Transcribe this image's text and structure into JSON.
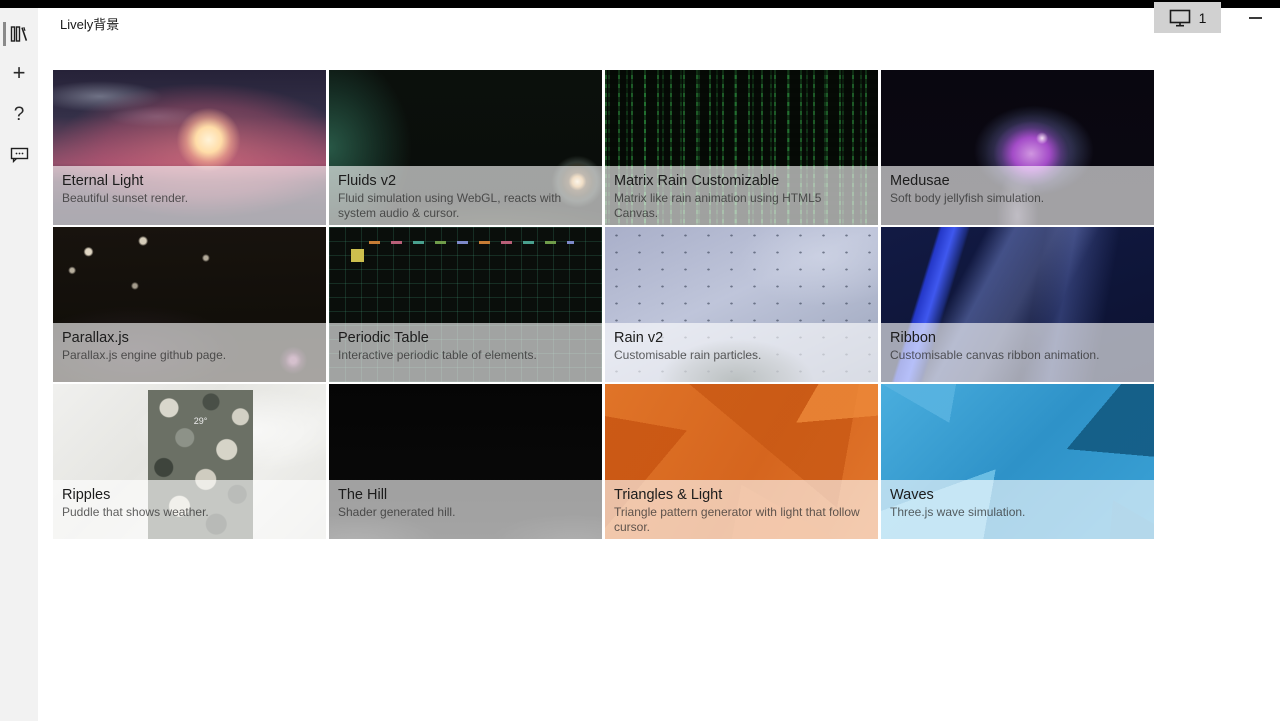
{
  "window": {
    "title": "Lively背景",
    "display_button": {
      "label": "1",
      "icon": "monitor-icon"
    },
    "minimize": {
      "icon": "minimize-icon"
    }
  },
  "sidebar": {
    "items": [
      {
        "id": "library",
        "icon": "library-icon",
        "selected": true
      },
      {
        "id": "add-wallpaper",
        "icon": "plus-icon",
        "glyph": "+"
      },
      {
        "id": "help",
        "icon": "help-icon",
        "glyph": "?"
      },
      {
        "id": "feedback",
        "icon": "feedback-icon"
      }
    ]
  },
  "cards": [
    {
      "title": "Eternal Light",
      "description": "Beautiful sunset render.",
      "thumb": "eternal-light"
    },
    {
      "title": "Fluids v2",
      "description": "Fluid simulation using WebGL, reacts with system audio & cursor.",
      "thumb": "fluids-v2"
    },
    {
      "title": "Matrix Rain Customizable",
      "description": "Matrix like rain animation using HTML5 Canvas.",
      "thumb": "matrix-rain"
    },
    {
      "title": "Medusae",
      "description": "Soft body jellyfish simulation.",
      "thumb": "medusae"
    },
    {
      "title": "Parallax.js",
      "description": "Parallax.js engine github page.",
      "thumb": "parallax-js"
    },
    {
      "title": "Periodic Table",
      "description": "Interactive periodic table of elements.",
      "thumb": "periodic-table"
    },
    {
      "title": "Rain v2",
      "description": "Customisable rain particles.",
      "thumb": "rain-v2"
    },
    {
      "title": "Ribbon",
      "description": "Customisable canvas ribbon animation.",
      "thumb": "ribbon"
    },
    {
      "title": "Ripples",
      "description": "Puddle that shows weather.",
      "thumb": "ripples",
      "overlay_text": "29°"
    },
    {
      "title": "The Hill",
      "description": "Shader generated hill.",
      "thumb": "the-hill"
    },
    {
      "title": "Triangles & Light",
      "description": "Triangle pattern generator with light that follow cursor.",
      "thumb": "triangles-light"
    },
    {
      "title": "Waves",
      "description": "Three.js wave simulation.",
      "thumb": "waves"
    }
  ],
  "colors": {
    "titlebar": "#000000",
    "sidebar_bg": "#f2f2f2",
    "display_button_bg": "#d1d1d1",
    "caption_overlay": "rgba(255,255,255,0.62)"
  }
}
